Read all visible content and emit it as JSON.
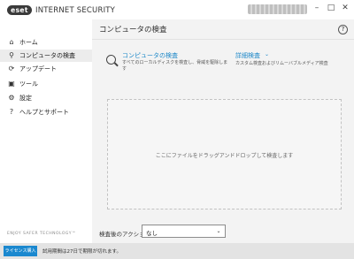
{
  "app": {
    "logo_text": "eset",
    "title": "INTERNET SECURITY",
    "window_controls": {
      "minimize": "–",
      "maximize": "□",
      "close": "✕"
    }
  },
  "sidebar": {
    "items": [
      {
        "label": "ホーム",
        "icon": "home-icon",
        "glyph": "⌂",
        "active": false
      },
      {
        "label": "コンピュータの検査",
        "icon": "search-icon",
        "glyph": "⚲",
        "active": true
      },
      {
        "label": "アップデート",
        "icon": "refresh-icon",
        "glyph": "⟳",
        "active": false
      },
      {
        "label": "ツール",
        "icon": "briefcase-icon",
        "glyph": "▣",
        "active": false
      },
      {
        "label": "設定",
        "icon": "gear-icon",
        "glyph": "⚙",
        "active": false
      },
      {
        "label": "ヘルプとサポート",
        "icon": "help-icon",
        "glyph": "?",
        "active": false
      }
    ],
    "footer": "ENJOY SAFER TECHNOLOGY™"
  },
  "main": {
    "page_title": "コンピュータの検査",
    "help_glyph": "?",
    "scan": {
      "title": "コンピュータの検査",
      "description": "すべてのローカルディスクを検査し、脅威を駆除します"
    },
    "advanced": {
      "title": "詳細検査",
      "chevron": "⌄",
      "description": "カスタム検査およびリムーバブルメディア検査"
    },
    "dropzone_text": "ここにファイルをドラッグアンドドロップして検査します",
    "post_scan": {
      "label": "検査後のアクション",
      "value": "なし",
      "chevron": "⌄"
    }
  },
  "status_bar": {
    "license_button": "ライセンス購入",
    "text": "試用期間は27日で期限が切れます。"
  },
  "colors": {
    "accent": "#1a88cf",
    "link": "#1e88c8",
    "main_bg": "#f3f3f3",
    "status_bg": "#e3e3e3"
  }
}
